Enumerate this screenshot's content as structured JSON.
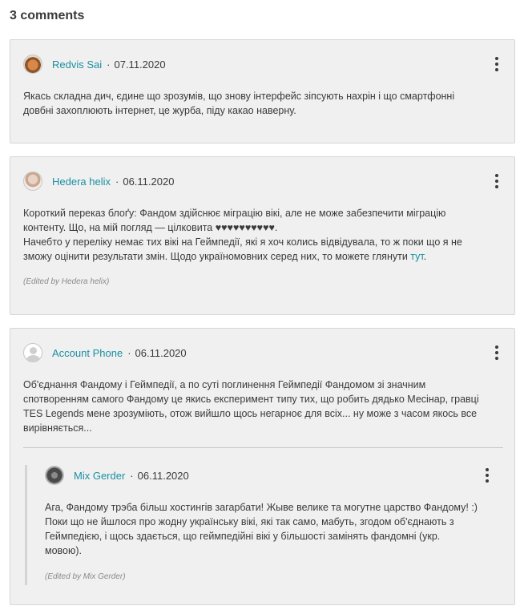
{
  "header": {
    "comment_count": "3 comments"
  },
  "comments": [
    {
      "author": "Redvis Sai",
      "separator": "·",
      "date": "07.11.2020",
      "avatar_icon": "fox-avatar",
      "lines": [
        "Якась складна дич, єдине що зрозумів, що знову інтерфейс зіпсують нахрін і що смартфонні",
        "довбні захоплюють інтернет, це журба, піду какао наверну."
      ]
    },
    {
      "author": "Hedera helix",
      "separator": "·",
      "date": "06.11.2020",
      "avatar_icon": "user-photo-avatar",
      "lines": [
        "Короткий переказ блоґу: Фандом здійснює міграцію вікі, але не може забезпечити міграцію",
        "контенту. Що, на мій погляд — цілковита ♥♥♥♥♥♥♥♥♥♥.",
        "Начебто у переліку немає тих вікі на Геймпедії, які я хоч колись відвідувала, то ж поки що я не"
      ],
      "last_line_text": "зможу оцінити результати змін. Щодо україномовних серед них, то можете глянути ",
      "link_text": "тут",
      "link_suffix": ".",
      "edited": "(Edited by Hedera helix)"
    },
    {
      "author": "Account Phone",
      "separator": "·",
      "date": "06.11.2020",
      "avatar_icon": "default-user-avatar",
      "lines": [
        "Об'єднання Фандому і Геймпедії, а по суті поглинення Геймпедії Фандомом зі значним",
        "спотворенням самого Фандому це якись експеримент типу тих, що робить дядько Месінар, гравці",
        "TES Legends мене зрозуміють, отож вийшло щось негарноє для всіх... ну може з часом якось все",
        "вирівняється..."
      ],
      "reply": {
        "author": "Mix Gerder",
        "separator": "·",
        "date": "06.11.2020",
        "avatar_icon": "dark-photo-avatar",
        "lines": [
          "Ага, Фандому трэба більш хостингів загарбати! Жыве велике та могутне царство Фандому! :)",
          "Поки що не йшлося про жодну українську вікі, які так само, мабуть, згодом об'єднають з",
          "Геймпедією, і щось здається, що геймпедійні вікі у більшості замінять фандомні (укр.",
          "мовою)."
        ],
        "edited": "(Edited by Mix Gerder)"
      }
    }
  ]
}
